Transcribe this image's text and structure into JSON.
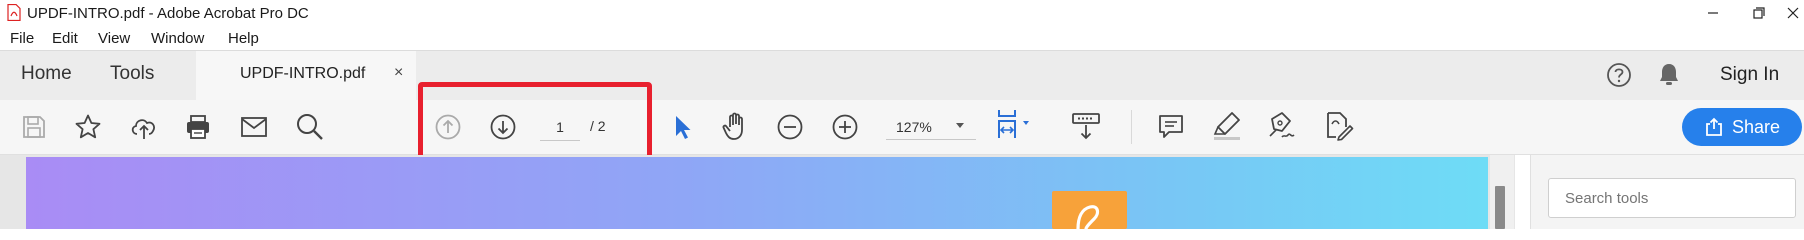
{
  "window": {
    "title": "UPDF-INTRO.pdf - Adobe Acrobat Pro DC"
  },
  "menu": [
    "File",
    "Edit",
    "View",
    "Window",
    "Help"
  ],
  "tabs": {
    "home": "Home",
    "tools": "Tools",
    "document": "UPDF-INTRO.pdf",
    "close_glyph": "×"
  },
  "header": {
    "sign_in": "Sign In"
  },
  "toolbar": {
    "page_current": "1",
    "page_total": "/  2",
    "zoom": "127%",
    "share_label": "Share"
  },
  "right_panel": {
    "search_placeholder": "Search tools"
  },
  "colors": {
    "accent": "#2680eb",
    "highlight": "#e8202e",
    "logo": "#f7a23a"
  },
  "icons": [
    "save-icon",
    "bookmark-star-icon",
    "upload-cloud-icon",
    "print-icon",
    "email-icon",
    "find-icon",
    "page-up-icon",
    "page-down-icon",
    "select-cursor-icon",
    "hand-icon",
    "zoom-out-icon",
    "zoom-in-icon",
    "fit-page-icon",
    "scroll-mode-icon",
    "comment-icon",
    "highlight-icon",
    "sign-icon",
    "edit-pdf-icon",
    "help-icon",
    "bell-icon"
  ]
}
